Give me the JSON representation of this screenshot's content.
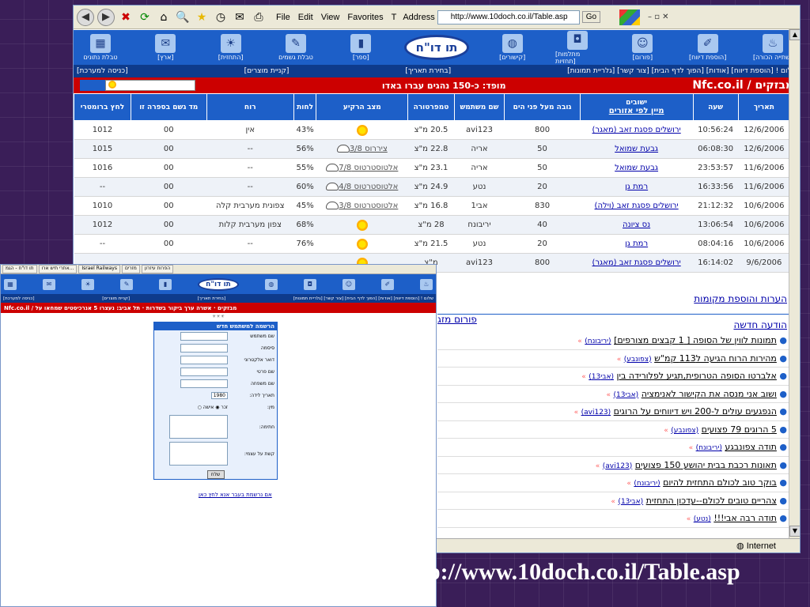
{
  "browser": {
    "menu": [
      "File",
      "Edit",
      "View",
      "Favorites",
      "T"
    ],
    "address_label": "Address",
    "url": "http://www.10doch.co.il/Table.asp",
    "go": "Go",
    "status": "Internet"
  },
  "nav": {
    "logo": "תו דו\"ח",
    "items": [
      "טבלת\nנתונים",
      "[ארץ]",
      "[התחזית]",
      "טבלת\nגשמים",
      "[ספר]",
      "[קישורים]",
      "[מתלמות\nתחזיות]",
      "[פורום]",
      "[הוספת\nדיווח]",
      "[שתייה\nהכורה]"
    ]
  },
  "links": {
    "right": "שלום ! [הוספת דיווח] [אודות] [הפוך לדף הבית] [צור קשר] [גלריית תמונות]",
    "mid": "[בחירת תאריך]",
    "left1": "[קניית מוצרים]",
    "left2": "[כניסה למערכת]"
  },
  "banner": {
    "brand": "Nfc.co.il / מבזקים",
    "msg": "מופד: כ-150 נהגים עברו באדו"
  },
  "table": {
    "headers": [
      "תאריך",
      "שעה",
      "ישובים",
      "מיין לפי אזורים",
      "גובה מעל פני הים",
      "שם משתמש",
      "טמפרטורה",
      "מצב הרקיע",
      "לחות",
      "רוח",
      "מד גשם בספרה זו",
      "לחץ ברומטרי"
    ],
    "rows": [
      {
        "date": "12/6/2006",
        "time": "10:56:24",
        "place": "ירושלים פסגת זאב (מאגר)",
        "alt": "800",
        "user": "avi123",
        "temp": "20.5 מ\"צ",
        "sky": "",
        "hum": "43%",
        "wind": "אין",
        "rain": "00",
        "press": "1012"
      },
      {
        "date": "12/6/2006",
        "time": "06:08:30",
        "place": "גבעת שמואל",
        "alt": "50",
        "user": "אריה",
        "temp": "22.8 מ\"צ",
        "sky": "ציררוס 3/8",
        "hum": "56%",
        "wind": "--",
        "rain": "00",
        "press": "1015"
      },
      {
        "date": "11/6/2006",
        "time": "23:53:57",
        "place": "גבעת שמואל",
        "alt": "50",
        "user": "אריה",
        "temp": "23.1 מ\"צ",
        "sky": "אלטוסטרטוס 7/8",
        "hum": "55%",
        "wind": "--",
        "rain": "00",
        "press": "1016"
      },
      {
        "date": "11/6/2006",
        "time": "16:33:56",
        "place": "רמת גן",
        "alt": "20",
        "user": "נטע",
        "temp": "24.9 מ\"צ",
        "sky": "אלטוסטרטוס 4/8",
        "hum": "60%",
        "wind": "--",
        "rain": "00",
        "press": "--"
      },
      {
        "date": "10/6/2006",
        "time": "21:12:32",
        "place": "ירושלים פסגת זאב (וילה)",
        "alt": "830",
        "user": "אבי1",
        "temp": "16.8 מ\"צ",
        "sky": "אלטוסטרטוס 3/8",
        "hum": "45%",
        "wind": "צפונית מערבית קלה",
        "rain": "00",
        "press": "1010"
      },
      {
        "date": "10/6/2006",
        "time": "13:06:54",
        "place": "נס ציונה",
        "alt": "40",
        "user": "יריבונח",
        "temp": "28 מ\"צ",
        "sky": "",
        "hum": "68%",
        "wind": "צפון מערבית קלות",
        "rain": "00",
        "press": "1012"
      },
      {
        "date": "10/6/2006",
        "time": "08:04:16",
        "place": "רמת גן",
        "alt": "20",
        "user": "נטע",
        "temp": "21.5 מ\"צ",
        "sky": "",
        "hum": "76%",
        "wind": "--",
        "rain": "00",
        "press": "--"
      },
      {
        "date": "9/6/2006",
        "time": "16:14:02",
        "place": "ירושלים פסגת זאב (מאגר)",
        "alt": "800",
        "user": "avi123",
        "temp": "מ\"צ",
        "sky": "",
        "hum": "",
        "wind": "",
        "rain": "",
        "press": ""
      }
    ]
  },
  "right": {
    "notes": "הערות והוספת מקומות",
    "new_msg": "הודעה חדשה",
    "forum": "פורום מזג",
    "posts": [
      {
        "t": "תמונות לווין של הסופה [ 1 קבצים מצורפים]",
        "u": "(יריבונח)"
      },
      {
        "t": "מהירות הרוח הגיעה ל113 קמ\"ש",
        "u": "(צפונבע)"
      },
      {
        "t": "אלברטו הסופה הטרופית,תגיע לפלורידה בין",
        "u": "(אבי13)"
      },
      {
        "t": "ושוב אני מנסה את הקישור לאנימציה",
        "u": "(אבי13)"
      },
      {
        "t": "הנפגעים עולים ל-200 ויש דיווחים על הרוגים",
        "u": "(avi123)"
      },
      {
        "t": "5 הרוגים 79 פצועים",
        "u": "(צפונבע)"
      },
      {
        "t": "תודה צפונבגע",
        "u": "(יריבונח)"
      },
      {
        "t": "תאונות רכבת בבית יהושע 150 פצועים",
        "u": "(avi123)"
      },
      {
        "t": "בוקר טוב לכולם התחזית להיום",
        "u": "(יריבונח)"
      },
      {
        "t": "צהריים טובים לכולם--עדכון התחזית",
        "u": "(אבי13)"
      },
      {
        "t": "תודה רבה אבי!!!",
        "u": "(נטע)"
      }
    ]
  },
  "win2": {
    "tabs": [
      "תו דו\"ח - הגמ",
      "אתרי תיש ארו...",
      "Israel Railways",
      "מזרים",
      "הפרות עיזרון"
    ],
    "red": "Nfc.co.il / מבזקים   ·  אשרה ערך ביקור בשדרות  ·  תל אביב: נעצרו 5 אנרכיסטים שמחאו על",
    "form_title": "הרשמה למשתמש חדש",
    "fields": [
      "שם משתמש",
      "סיסמה",
      "דואר אלקטרוני",
      "שם פרטי",
      "שם משפחה"
    ],
    "dob_label": "תאריך לידה:",
    "dob_year": "1980",
    "gender_label": "מין:",
    "gender_opts": "זכר ◉ אישה ○",
    "sig_label": "חתימה:",
    "link_label": "קשת על עצמי:",
    "submit": "שלח",
    "signup_link": "אם נרשמת בעבר אנא לחץ כאן"
  },
  "footer_url": "p://www.10doch.co.il/Table.asp"
}
